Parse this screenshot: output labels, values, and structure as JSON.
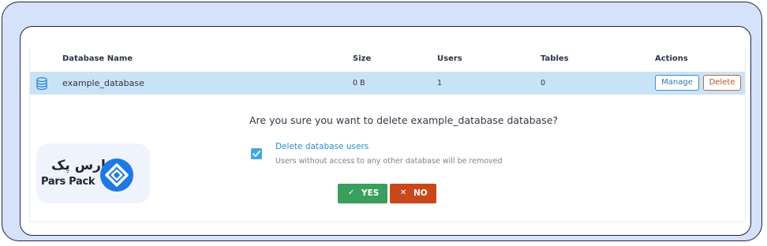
{
  "table": {
    "columns": {
      "name": "Database Name",
      "size": "Size",
      "users": "Users",
      "tables": "Tables",
      "actions": "Actions"
    },
    "rows": [
      {
        "icon": "database-icon",
        "name": "example_database",
        "size": "0 B",
        "users": "1",
        "tables": "0",
        "manage_label": "Manage",
        "delete_label": "Delete"
      }
    ]
  },
  "confirm": {
    "question": "Are you sure you want to delete example_database database?",
    "option_label": "Delete database users",
    "option_checked": true,
    "option_help": "Users without access to any other database will be removed",
    "yes_label": "YES",
    "no_label": "NO",
    "yes_icon": "check-icon",
    "no_icon": "close-icon"
  },
  "branding": {
    "logo_fa": "پارس پک",
    "logo_en": "Pars Pack"
  },
  "colors": {
    "row_highlight": "#c9e3f6",
    "yes_button": "#3a9f5c",
    "no_button": "#c9481b",
    "checkbox": "#3fa6e0",
    "frame_bg": "#d6e2fa",
    "frame_border": "#1c2448",
    "logo_accent": "#1e7ae0"
  }
}
